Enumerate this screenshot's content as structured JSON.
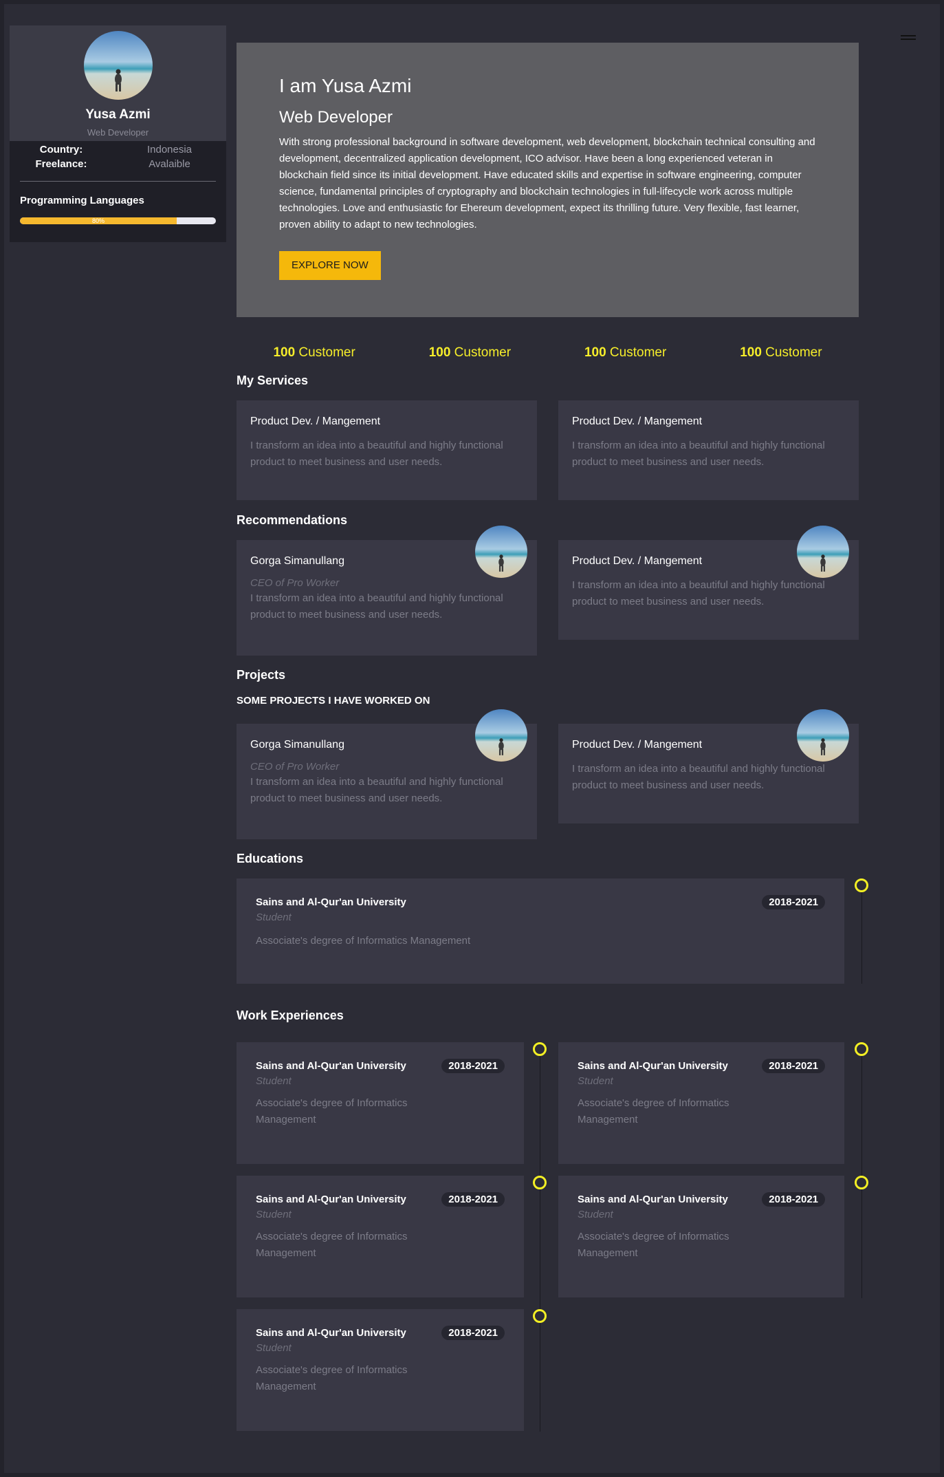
{
  "profile": {
    "name": "Yusa Azmi",
    "role": "Web Developer",
    "country_label": "Country:",
    "country_value": "Indonesia",
    "freelance_label": "Freelance:",
    "freelance_value": "Avalaible",
    "languages_title": "Programming Languages",
    "languages_progress_text": "80%",
    "languages_progress": 0.8
  },
  "hero": {
    "heading": "I am Yusa Azmi",
    "subheading": "Web Developer",
    "description": "With strong professional background in software development, web development, blockchain technical consulting and development, decentralized application development, ICO advisor. Have been a long experienced veteran in blockchain field since its initial development. Have educated skills and expertise in software engineering, computer science, fundamental principles of cryptography and blockchain technologies in full-lifecycle work across multiple technologies. Love and enthusiastic for Ehereum development, expect its thrilling future. Very flexible, fast learner, proven ability to adapt to new technologies.",
    "button_label": "EXPLORE NOW"
  },
  "counters": [
    {
      "number": "100",
      "label": " Customer"
    },
    {
      "number": "100",
      "label": " Customer"
    },
    {
      "number": "100",
      "label": " Customer"
    },
    {
      "number": "100",
      "label": " Customer"
    }
  ],
  "services": {
    "title": "My Services",
    "items": [
      {
        "title": "Product Dev. / Mangement",
        "text": "I transform an idea into a beautiful and highly functional product to meet business and user needs."
      },
      {
        "title": "Product Dev. / Mangement",
        "text": "I transform an idea into a beautiful and highly functional product to meet business and user needs."
      }
    ]
  },
  "recommendations": {
    "title": "Recommendations",
    "items": [
      {
        "title": "Gorga Simanullang",
        "sub": "CEO of Pro Worker",
        "text": "I transform an idea into a beautiful and highly functional product to meet business and user needs."
      },
      {
        "title": "Product Dev. / Mangement",
        "text": "I transform an idea into a beautiful and highly functional product to meet business and user needs."
      }
    ]
  },
  "projects": {
    "title": "Projects",
    "subtitle": "SOME PROJECTS I HAVE WORKED ON",
    "items": [
      {
        "title": "Gorga Simanullang",
        "sub": "CEO of Pro Worker",
        "text": "I transform an idea into a beautiful and highly functional product to meet business and user needs."
      },
      {
        "title": "Product Dev. / Mangement",
        "text": "I transform an idea into a beautiful and highly functional product to meet business and user needs."
      }
    ]
  },
  "educations": {
    "title": "Educations",
    "items": [
      {
        "school": "Sains and Al-Qur'an University",
        "year": "2018-2021",
        "role": "Student",
        "desc": "Associate's degree of Informatics Management"
      }
    ]
  },
  "work": {
    "title": "Work Experiences",
    "items": [
      {
        "school": "Sains and Al-Qur'an University",
        "year": "2018-2021",
        "role": "Student",
        "desc": "Associate's degree of Informatics Management"
      },
      {
        "school": "Sains and Al-Qur'an University",
        "year": "2018-2021",
        "role": "Student",
        "desc": "Associate's degree of Informatics Management"
      },
      {
        "school": "Sains and Al-Qur'an University",
        "year": "2018-2021",
        "role": "Student",
        "desc": "Associate's degree of Informatics Management"
      },
      {
        "school": "Sains and Al-Qur'an University",
        "year": "2018-2021",
        "role": "Student",
        "desc": "Associate's degree of Informatics Management"
      },
      {
        "school": "Sains and Al-Qur'an University",
        "year": "2018-2021",
        "role": "Student",
        "desc": "Associate's degree of Informatics Management"
      }
    ]
  },
  "colors": {
    "accent_yellow": "#f5b80b",
    "counter_yellow": "#f6ee2a",
    "background": "#2c2c36",
    "card": "#393845"
  }
}
